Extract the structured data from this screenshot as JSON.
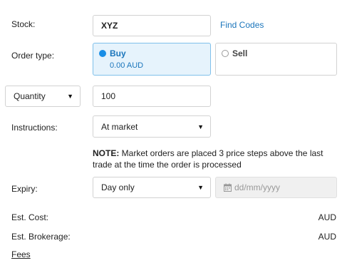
{
  "stock": {
    "label": "Stock:",
    "value": "XYZ",
    "find_codes_label": "Find Codes"
  },
  "order_type": {
    "label": "Order type:",
    "buy": {
      "label": "Buy",
      "amount": "0.00 AUD",
      "selected": true
    },
    "sell": {
      "label": "Sell",
      "selected": false
    }
  },
  "quantity": {
    "mode": "Quantity",
    "value": "100"
  },
  "instructions": {
    "label": "Instructions:",
    "value": "At market"
  },
  "note": {
    "prefix": "NOTE:",
    "text": " Market orders are placed 3 price steps above the last trade at the time the order is processed"
  },
  "expiry": {
    "label": "Expiry:",
    "value": "Day only",
    "date_placeholder": "dd/mm/yyyy"
  },
  "est_cost": {
    "label": "Est. Cost:",
    "currency": "AUD"
  },
  "est_brokerage": {
    "label": "Est. Brokerage:",
    "currency": "AUD"
  },
  "fees": {
    "label": "Fees"
  },
  "icons": {
    "calendar": "calendar-icon",
    "caret": "caret-down-icon"
  },
  "colors": {
    "accent": "#1a75bb",
    "radio_selected": "#1a8ee6",
    "buy_bg": "#e6f3fc",
    "buy_border": "#7fc0ea"
  }
}
